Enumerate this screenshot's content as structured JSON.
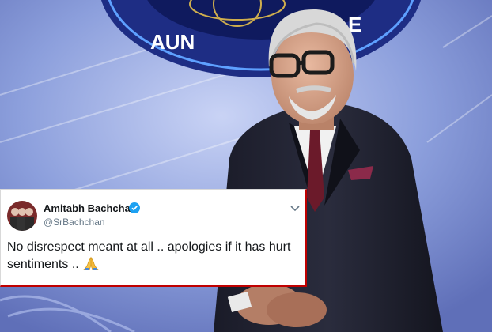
{
  "background": {
    "logo_text": "AUN BANEGA",
    "colors": {
      "stage": "#8fa3d9",
      "logo_ring": "#2b3f9e",
      "suit": "#1b1c2a"
    }
  },
  "tweet": {
    "author_name": "Amitabh Bachchan",
    "handle": "@SrBachchan",
    "verified": true,
    "text": "No disrespect meant at all .. apologies if it has hurt sentiments  ..",
    "emoji": "folded-hands-icon",
    "accent_color": "#1da1f2"
  }
}
